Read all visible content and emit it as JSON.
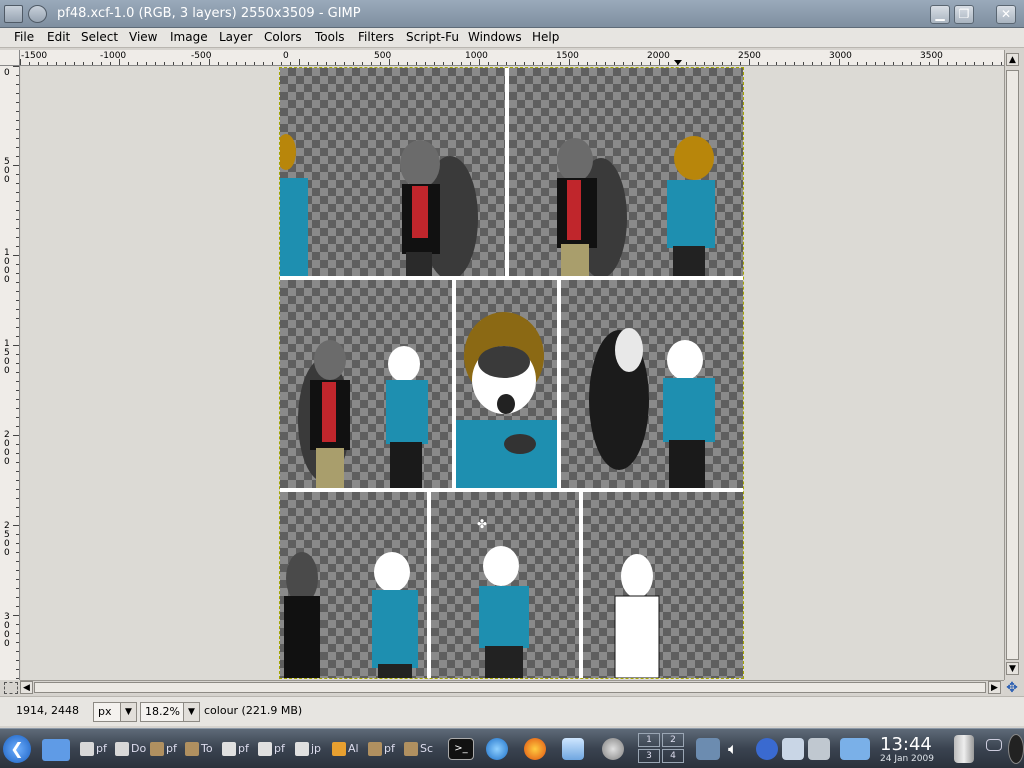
{
  "window": {
    "title": "pf48.xcf-1.0 (RGB, 3 layers) 2550x3509 - GIMP",
    "minimize_glyph": "▁",
    "maximize_glyph": "❐",
    "close_glyph": "✕"
  },
  "menu": {
    "items": [
      "File",
      "Edit",
      "Select",
      "View",
      "Image",
      "Layer",
      "Colors",
      "Tools",
      "Filters",
      "Script-Fu",
      "Windows",
      "Help"
    ]
  },
  "ruler": {
    "top_labels": [
      "-1500",
      "-1000",
      "-500",
      "0",
      "500",
      "1000",
      "1500",
      "2000",
      "2500",
      "3000",
      "3500"
    ],
    "left_labels": [
      "0",
      "500",
      "1000",
      "1500",
      "2000",
      "2500",
      "3000"
    ]
  },
  "status": {
    "coordinates": "1914, 2448",
    "unit": "px",
    "zoom": "18.2%",
    "message": "colour (221.9 MB)"
  },
  "taskbar": {
    "tasks": [
      {
        "label": "pf",
        "icon": "document-icon"
      },
      {
        "label": "Do",
        "icon": "document-icon"
      },
      {
        "label": "pf",
        "icon": "gimp-icon"
      },
      {
        "label": "To",
        "icon": "gimp-icon"
      },
      {
        "label": "pf",
        "icon": "image-icon"
      },
      {
        "label": "pf",
        "icon": "image-icon"
      },
      {
        "label": "jp",
        "icon": "image-icon"
      },
      {
        "label": "Al",
        "icon": "app-icon"
      },
      {
        "label": "pf",
        "icon": "gimp-icon"
      },
      {
        "label": "Sc",
        "icon": "gimp-icon"
      }
    ],
    "pager": [
      "1",
      "2",
      "3",
      "4"
    ],
    "clock_time": "13:44",
    "clock_date": "24 Jan 2009"
  },
  "colors": {
    "title_bar": "#8a9aab",
    "checker_dark": "#5f5f5f",
    "checker_light": "#8a8a8a",
    "canvas_bg": "#dcdad5"
  }
}
